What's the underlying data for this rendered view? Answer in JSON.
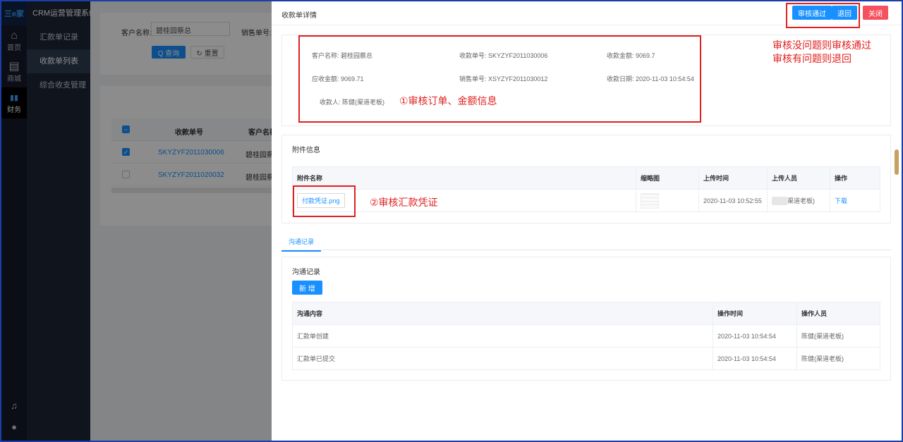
{
  "app": {
    "logo_text": "三e家",
    "system_title": "CRM运营管理系统"
  },
  "rail": [
    {
      "icon": "home-icon",
      "glyph": "⌂",
      "label": "首页"
    },
    {
      "icon": "mall-icon",
      "glyph": "▤",
      "label": "商城"
    },
    {
      "icon": "finance-icon",
      "glyph": "▮▮",
      "label": "财务"
    }
  ],
  "rail_bottom": {
    "bell_glyph": "♫",
    "user_glyph": "●"
  },
  "menu": {
    "items": [
      "汇款单记录",
      "收款单列表",
      "综合收支管理"
    ]
  },
  "bg_page": {
    "customer_label": "客户名称:",
    "customer_value": "碧桂园蔡总",
    "sales_label": "销售单号:",
    "search_btn": "Q 查询",
    "reset_btn": "↻ 重置",
    "col_no": "收款单号",
    "col_customer": "客户名称",
    "rows": [
      {
        "no": "SKYZYF2011030006",
        "customer": "碧桂园蔡总",
        "checked": true
      },
      {
        "no": "SKYZYF2011020032",
        "customer": "碧桂园蔡总",
        "checked": false
      }
    ]
  },
  "drawer": {
    "title": "收款单详情",
    "approve_btn": "审核通过",
    "reject_btn": "退回",
    "close_btn": "关闭",
    "info": {
      "customer_label": "客户名称:",
      "customer_value": "碧桂园蔡总",
      "receipt_no_label": "收款单号:",
      "receipt_no_value": "SKYZYF2011030006",
      "amount_label": "收款金额:",
      "amount_value": "9069.7",
      "due_label": "应收金额:",
      "due_value": "9069.71",
      "sales_no_label": "销售单号:",
      "sales_no_value": "XSYZYF2011030012",
      "date_label": "收款日期:",
      "date_value": "2020-11-03 10:54:54",
      "payee_label": "收款人:",
      "payee_value": "陈健(渠道老板)"
    },
    "attachments": {
      "section_title": "附件信息",
      "headers": [
        "附件名称",
        "缩略图",
        "上传时间",
        "上传人员",
        "操作"
      ],
      "row": {
        "file": "付款凭证.png",
        "time": "2020-11-03 10:52:55",
        "uploader": "渠道老板)",
        "action": "下载"
      }
    },
    "tab_label": "沟通记录",
    "communication": {
      "section_title": "沟通记录",
      "add_btn": "新 增",
      "headers": [
        "沟通内容",
        "操作时间",
        "操作人员"
      ],
      "rows": [
        {
          "content": "汇款单创建",
          "time": "2020-11-03 10:54:54",
          "operator": "陈健(渠道老板)"
        },
        {
          "content": "汇款单已提交",
          "time": "2020-11-03 10:54:54",
          "operator": "陈健(渠道老板)"
        }
      ]
    }
  },
  "annotations": {
    "note_info": "①审核订单、金额信息",
    "note_attach": "②审核汇款凭证",
    "note_top_line1": "审核没问题则审核通过",
    "note_top_line2": "审核有问题则退回"
  },
  "colors": {
    "primary": "#1890ff",
    "danger": "#f5515f",
    "annotation": "#e02020",
    "sidebar": "#1d2535"
  }
}
